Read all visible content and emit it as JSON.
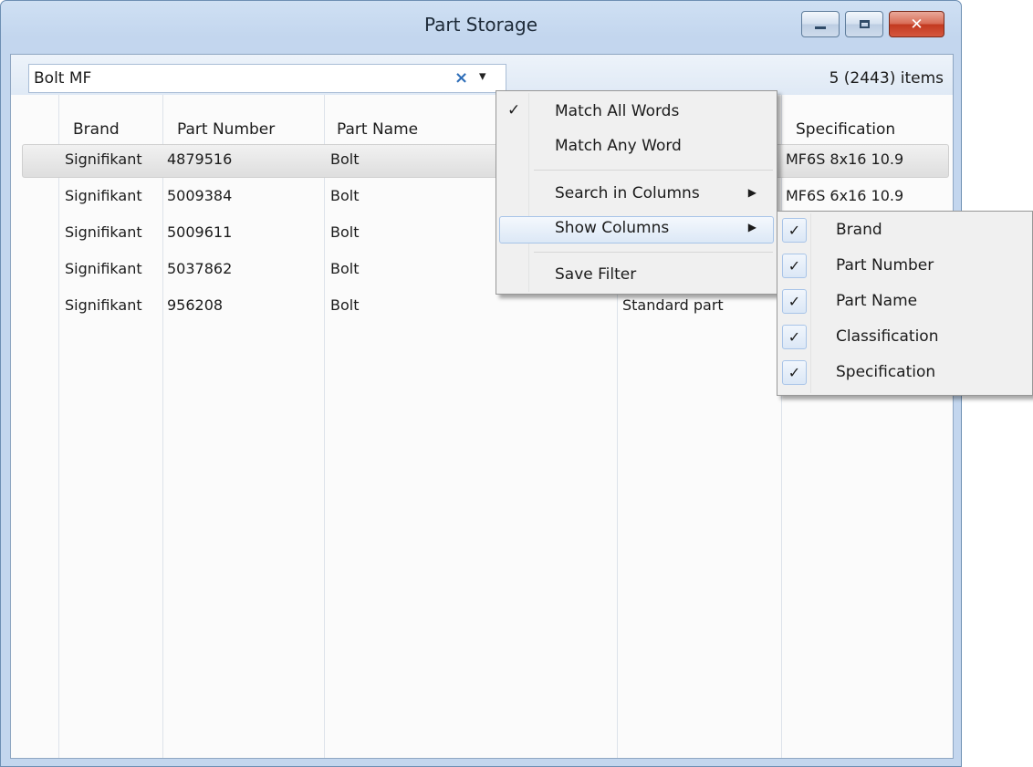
{
  "window": {
    "title": "Part Storage",
    "controls": {
      "minimize": "",
      "maximize": "",
      "close": "✕"
    }
  },
  "search": {
    "value": "Bolt MF",
    "clear_icon": "×",
    "dropdown_icon": "▾",
    "item_count": "5 (2443) items"
  },
  "table": {
    "columns": [
      "Brand",
      "Part Number",
      "Part Name",
      "Specification"
    ],
    "rows": [
      {
        "brand": "Signifikant",
        "part_number": "4879516",
        "part_name": "Bolt",
        "classification": "",
        "specification": "MF6S  8x16  10.9"
      },
      {
        "brand": "Signifikant",
        "part_number": "5009384",
        "part_name": "Bolt",
        "classification": "",
        "specification": "MF6S  6x16  10.9"
      },
      {
        "brand": "Signifikant",
        "part_number": "5009611",
        "part_name": "Bolt",
        "classification": "",
        "specification": ""
      },
      {
        "brand": "Signifikant",
        "part_number": "5037862",
        "part_name": "Bolt",
        "classification": "",
        "specification": ""
      },
      {
        "brand": "Signifikant",
        "part_number": "956208",
        "part_name": "Bolt",
        "classification": "Standard part",
        "specification": ""
      }
    ]
  },
  "context_menu": {
    "items": [
      {
        "label": "Match All Words",
        "checked": "✓"
      },
      {
        "label": "Match Any Word"
      },
      {
        "label": "Search in Columns",
        "arrow": "▶"
      },
      {
        "label": "Show Columns",
        "arrow": "▶"
      },
      {
        "label": "Save Filter"
      }
    ]
  },
  "columns_submenu": {
    "items": [
      {
        "label": "Brand",
        "checked": "✓"
      },
      {
        "label": "Part Number",
        "checked": "✓"
      },
      {
        "label": "Part Name",
        "checked": "✓"
      },
      {
        "label": "Classification",
        "checked": "✓"
      },
      {
        "label": "Specification",
        "checked": "✓"
      }
    ]
  }
}
